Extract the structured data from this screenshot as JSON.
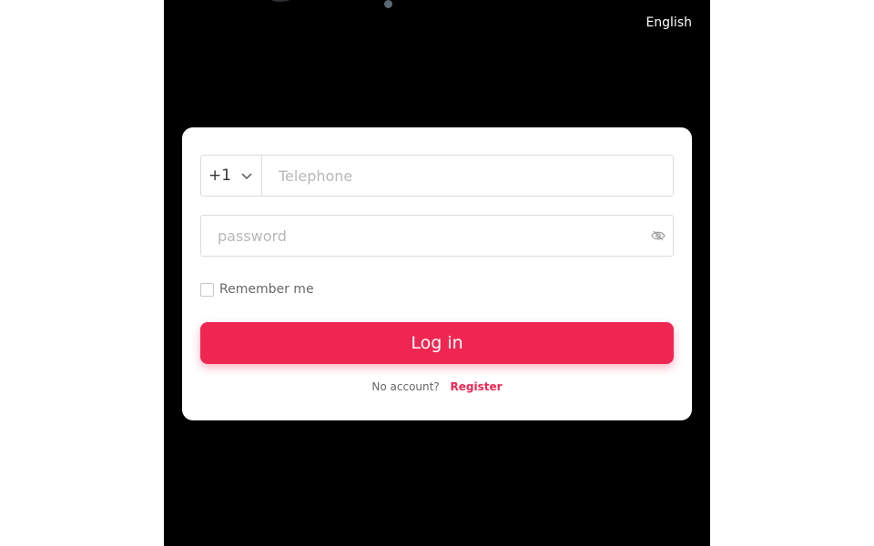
{
  "header": {
    "language": "English"
  },
  "login": {
    "country_code": "+1",
    "telephone_placeholder": "Telephone",
    "telephone_value": "",
    "password_placeholder": "password",
    "password_value": "",
    "remember_label": "Remember me",
    "remember_checked": false,
    "login_label": "Log in",
    "no_account_text": "No account?",
    "register_label": "Register"
  },
  "colors": {
    "accent": "#ef2651",
    "background": "#000000",
    "card": "#ffffff"
  },
  "icons": {
    "country_chevron": "chevron-down-icon",
    "password_toggle": "eye-off-icon"
  }
}
